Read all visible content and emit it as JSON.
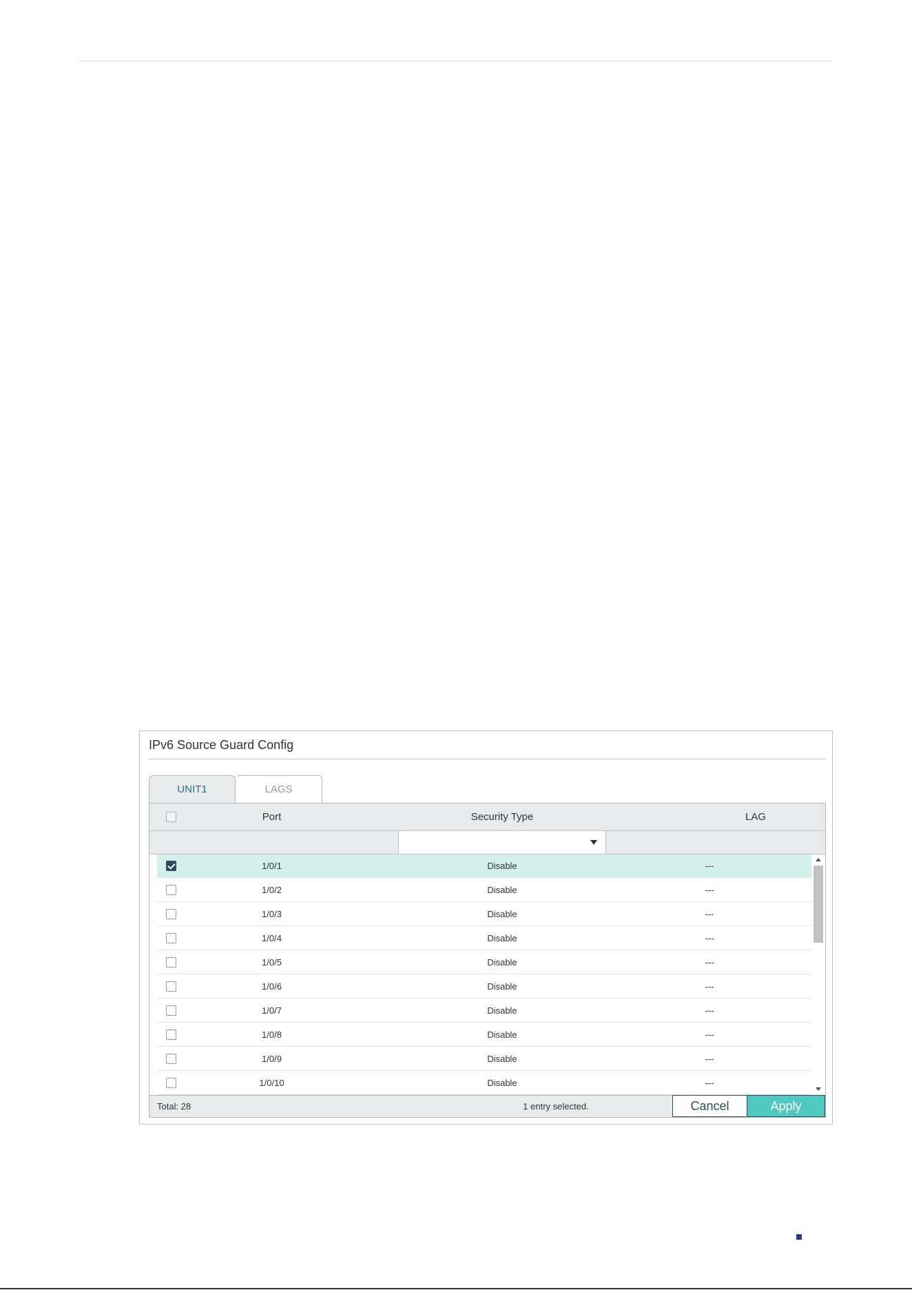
{
  "panel": {
    "title": "IPv6 Source Guard Config"
  },
  "tabs": [
    {
      "label": "UNIT1",
      "active": true
    },
    {
      "label": "LAGS",
      "active": false
    }
  ],
  "table": {
    "columns": [
      "Port",
      "Security Type",
      "LAG"
    ],
    "filter": {
      "security_type_selected": ""
    },
    "rows": [
      {
        "checked": true,
        "port": "1/0/1",
        "security_type": "Disable",
        "lag": "---"
      },
      {
        "checked": false,
        "port": "1/0/2",
        "security_type": "Disable",
        "lag": "---"
      },
      {
        "checked": false,
        "port": "1/0/3",
        "security_type": "Disable",
        "lag": "---"
      },
      {
        "checked": false,
        "port": "1/0/4",
        "security_type": "Disable",
        "lag": "---"
      },
      {
        "checked": false,
        "port": "1/0/5",
        "security_type": "Disable",
        "lag": "---"
      },
      {
        "checked": false,
        "port": "1/0/6",
        "security_type": "Disable",
        "lag": "---"
      },
      {
        "checked": false,
        "port": "1/0/7",
        "security_type": "Disable",
        "lag": "---"
      },
      {
        "checked": false,
        "port": "1/0/8",
        "security_type": "Disable",
        "lag": "---"
      },
      {
        "checked": false,
        "port": "1/0/9",
        "security_type": "Disable",
        "lag": "---"
      },
      {
        "checked": false,
        "port": "1/0/10",
        "security_type": "Disable",
        "lag": "---"
      }
    ]
  },
  "footer": {
    "total": "Total: 28",
    "selected_info": "1 entry selected.",
    "cancel_label": "Cancel",
    "apply_label": "Apply"
  },
  "colors": {
    "accent": "#4fc8c0",
    "selected_row": "#d3f0ea",
    "header_bg": "#e8eaeb",
    "dark_blue": "#2e4a62"
  }
}
